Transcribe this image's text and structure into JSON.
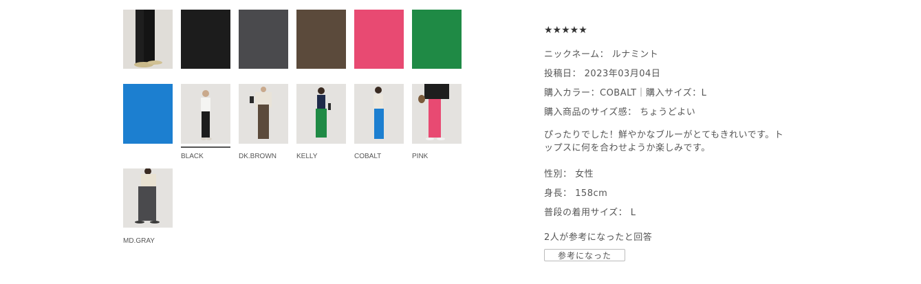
{
  "colors": {
    "black": "#1c1c1c",
    "md_gray": "#4a4a4d",
    "dk_brown": "#5b4a3b",
    "pink": "#e84a72",
    "kelly": "#1f8a45",
    "cobalt": "#1c7fd0",
    "photo_bg": "#e3e1de"
  },
  "swatches": [
    {
      "name": "black",
      "label": "BLACK",
      "selected": true
    },
    {
      "name": "dk_brown",
      "label": "DK.BROWN"
    },
    {
      "name": "kelly",
      "label": "KELLY"
    },
    {
      "name": "cobalt",
      "label": "COBALT"
    },
    {
      "name": "pink",
      "label": "PINK"
    },
    {
      "name": "md_gray",
      "label": "MD.GRAY"
    }
  ],
  "review": {
    "stars": "★★★★★",
    "nickname_label": "ニックネーム：",
    "nickname": "ルナミント",
    "posted_label": "投稿日：",
    "posted_date": "2023年03月04日",
    "purchase_line": "購入カラー：COBALT｜購入サイズ：L",
    "fit_label": "購入商品のサイズ感：",
    "fit_value": "ちょうどよい",
    "comment": "ぴったりでした！鮮やかなブルーがとてもきれいです。トップスに何を合わせようか楽しみです。",
    "gender_label": "性別：",
    "gender": "女性",
    "height_label": "身長：",
    "height": "158cm",
    "usual_size_label": "普段の着用サイズ：",
    "usual_size": "L",
    "helpful_count_text": "2人が参考になったと回答",
    "helpful_button": "参考になった"
  }
}
